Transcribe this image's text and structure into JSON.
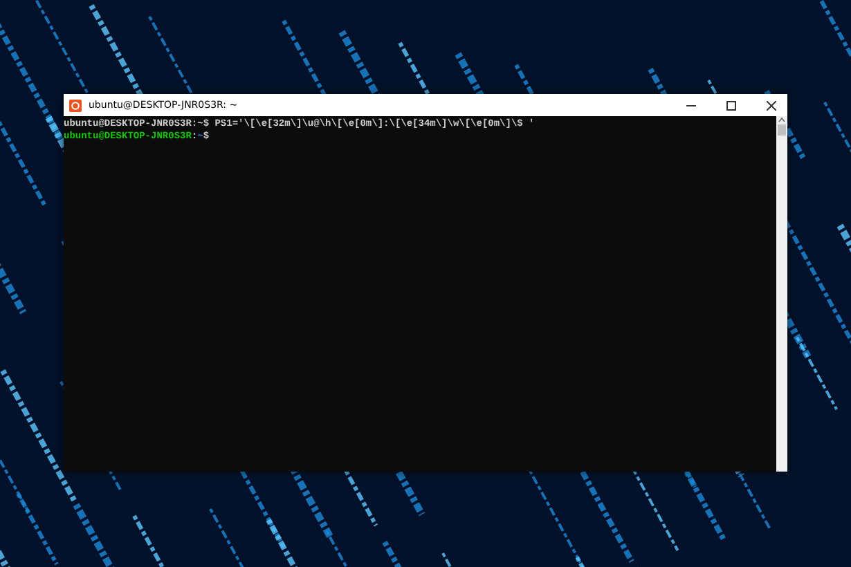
{
  "window": {
    "title": "ubuntu@DESKTOP-JNR0S3R: ~"
  },
  "terminal": {
    "lines": [
      {
        "segments": [
          {
            "text": "ubuntu@DESKTOP-JNR0S3R:~$ PS1='\\[\\e[32m\\]\\u@\\h\\[\\e[0m\\]:\\[\\e[34m\\]\\w\\[\\e[0m\\]\\$ '",
            "color": "#cccccc"
          }
        ]
      },
      {
        "segments": [
          {
            "text": "ubuntu@DESKTOP-JNR0S3R",
            "color": "#16c60c"
          },
          {
            "text": ":",
            "color": "#cccccc"
          },
          {
            "text": "~",
            "color": "#3b78ff"
          },
          {
            "text": "$",
            "color": "#cccccc"
          }
        ]
      }
    ]
  }
}
